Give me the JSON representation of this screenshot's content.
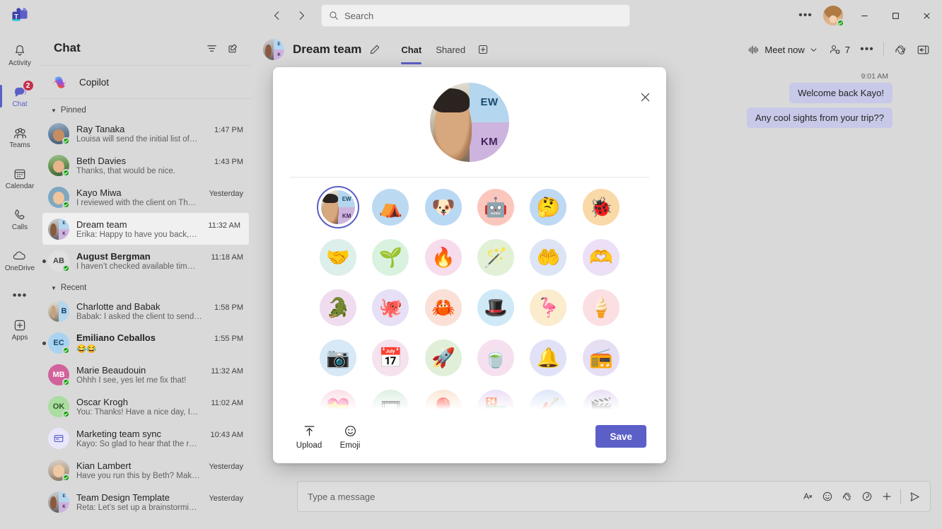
{
  "titlebar": {
    "app_name": "Microsoft Teams",
    "back_icon": "chevron-left-icon",
    "forward_icon": "chevron-right-icon",
    "search_placeholder": "Search",
    "search_icon": "search-icon",
    "more_label": "•••",
    "minimize_label": "–",
    "maximize_label": "❐",
    "close_label": "✕"
  },
  "rail": {
    "items": [
      {
        "label": "Activity",
        "icon": "bell-icon",
        "badge": "",
        "active": false
      },
      {
        "label": "Chat",
        "icon": "chat-bubble-icon",
        "badge": "2",
        "active": true
      },
      {
        "label": "Teams",
        "icon": "teams-people-icon",
        "badge": "",
        "active": false
      },
      {
        "label": "Calendar",
        "icon": "calendar-icon",
        "badge": "",
        "active": false
      },
      {
        "label": "Calls",
        "icon": "phone-icon",
        "badge": "",
        "active": false
      },
      {
        "label": "OneDrive",
        "icon": "cloud-icon",
        "badge": "",
        "active": false
      }
    ],
    "more_label": "•••",
    "apps_label": "Apps",
    "apps_icon": "plus-square-icon"
  },
  "chat_pane": {
    "title": "Chat",
    "filter_icon": "filter-icon",
    "compose_icon": "new-chat-icon",
    "copilot_label": "Copilot",
    "copilot_icon": "copilot-icon",
    "groups": [
      {
        "label": "Pinned",
        "items": [
          {
            "name": "Ray Tanaka",
            "preview": "Louisa will send the initial list of…",
            "time": "1:47 PM",
            "unread": false,
            "selected": false,
            "avatar_type": "photo",
            "photo": "ph1",
            "presence": true
          },
          {
            "name": "Beth Davies",
            "preview": "Thanks, that would be nice.",
            "time": "1:43 PM",
            "unread": false,
            "selected": false,
            "avatar_type": "photo",
            "photo": "ph2",
            "presence": true
          },
          {
            "name": "Kayo Miwa",
            "preview": "I reviewed with the client on Th…",
            "time": "Yesterday",
            "unread": false,
            "selected": false,
            "avatar_type": "photo",
            "photo": "ph3",
            "presence": true
          },
          {
            "name": "Dream team",
            "preview": "Erika: Happy to have you back,…",
            "time": "11:32 AM",
            "unread": false,
            "selected": true,
            "avatar_type": "split",
            "photo": "ph5",
            "initials_top": "E",
            "initials_bottom": "K",
            "presence": false
          },
          {
            "name": "August Bergman",
            "preview": "I haven’t checked available tim…",
            "time": "11:18 AM",
            "unread": true,
            "selected": false,
            "avatar_type": "initials",
            "initials": "AB",
            "color": "#e0e0e0",
            "text_color": "#424242",
            "presence": true
          }
        ]
      },
      {
        "label": "Recent",
        "items": [
          {
            "name": "Charlotte and Babak",
            "preview": "Babak: I asked the client to send…",
            "time": "1:58 PM",
            "unread": false,
            "selected": false,
            "avatar_type": "split2",
            "photo": "ph6",
            "initials_top": "B",
            "presence": false
          },
          {
            "name": "Emiliano Ceballos",
            "preview": "😂😂",
            "time": "1:55 PM",
            "unread": true,
            "selected": false,
            "avatar_type": "initials",
            "initials": "EC",
            "color": "#a9d3f0",
            "text_color": "#1b4a6b",
            "presence": true
          },
          {
            "name": "Marie Beaudouin",
            "preview": "Ohhh I see, yes let me fix that!",
            "time": "11:32 AM",
            "unread": false,
            "selected": false,
            "avatar_type": "initials",
            "initials": "MB",
            "color": "#d2629b",
            "text_color": "#ffffff",
            "presence": true
          },
          {
            "name": "Oscar Krogh",
            "preview": "You: Thanks! Have a nice day, I…",
            "time": "11:02 AM",
            "unread": false,
            "selected": false,
            "avatar_type": "initials",
            "initials": "OK",
            "color": "#aadda0",
            "text_color": "#2c5a26",
            "presence": true
          },
          {
            "name": "Marketing team sync",
            "preview": "Kayo: So glad to hear that the r…",
            "time": "10:43 AM",
            "unread": false,
            "selected": false,
            "avatar_type": "icon",
            "icon": "meeting-icon",
            "color": "#e8e6fb",
            "text_color": "#5b5fc7",
            "presence": false
          },
          {
            "name": "Kian Lambert",
            "preview": "Have you run this by Beth? Mak…",
            "time": "Yesterday",
            "unread": false,
            "selected": false,
            "avatar_type": "photo",
            "photo": "ph4",
            "presence": true
          },
          {
            "name": "Team Design Template",
            "preview": "Reta: Let’s set up a brainstormi…",
            "time": "Yesterday",
            "unread": false,
            "selected": false,
            "avatar_type": "split",
            "photo": "ph5",
            "initials_top": "E",
            "initials_bottom": "K",
            "presence": false
          }
        ]
      }
    ]
  },
  "conversation": {
    "title": "Dream team",
    "edit_icon": "pencil-icon",
    "tabs": [
      {
        "label": "Chat",
        "active": true
      },
      {
        "label": "Shared",
        "active": false
      }
    ],
    "add_tab_icon": "plus-square-icon",
    "meet_now_label": "Meet now",
    "meet_now_icon": "meet-now-icon",
    "meet_now_chevron": "chevron-down-icon",
    "participants_icon": "add-people-icon",
    "participants_count": "7",
    "overflow_label": "•••",
    "copilot_icon": "copilot-icon",
    "open_pane_icon": "side-pane-icon",
    "messages": [
      {
        "time": "9:01 AM",
        "text": "Welcome back Kayo!",
        "align": "right"
      },
      {
        "time": "",
        "text": "Any cool sights from your trip??",
        "align": "right"
      }
    ],
    "compose": {
      "placeholder": "Type a message",
      "icons": [
        "format-icon",
        "emoji-icon",
        "copilot-icon",
        "sticker-icon",
        "plus-icon",
        "send-icon"
      ]
    }
  },
  "dialog": {
    "name": "avatar-picker",
    "close_icon": "close-icon",
    "hero": {
      "initial_top": "EW",
      "initial_bottom": "KM",
      "top_color": "#b4d6ee",
      "bottom_color": "#cdb4de"
    },
    "avatars": [
      {
        "name": "current-group-avatar",
        "type": "selected",
        "initial_top": "EW",
        "initial_bottom": "KM",
        "bg": "#ffffff"
      },
      {
        "name": "camping-avatar",
        "emoji": "⛺",
        "bg": "#bcd9f2"
      },
      {
        "name": "dog-avatar",
        "emoji": "🐶",
        "bg": "#b9d8f3"
      },
      {
        "name": "robot-avatar",
        "emoji": "🤖",
        "bg": "#fbc7bd"
      },
      {
        "name": "thinking-face-avatar",
        "emoji": "🤔",
        "bg": "#bdd9f4"
      },
      {
        "name": "bug-avatar",
        "emoji": "🐞",
        "bg": "#fad9a8"
      },
      {
        "name": "teamwork-hands-avatar",
        "emoji": "🤝",
        "bg": "#dcefeb"
      },
      {
        "name": "leaf-in-hand-avatar",
        "emoji": "🌱",
        "bg": "#d9f2e0"
      },
      {
        "name": "flame-in-hands-avatar",
        "emoji": "🔥",
        "bg": "#f7dced"
      },
      {
        "name": "magic-wand-avatar",
        "emoji": "🪄",
        "bg": "#e2f1d6"
      },
      {
        "name": "handshake-avatar",
        "emoji": "🤲",
        "bg": "#dde4f6"
      },
      {
        "name": "heart-hands-avatar",
        "emoji": "🫶",
        "bg": "#ece0f6"
      },
      {
        "name": "dinosaur-avatar",
        "emoji": "🐊",
        "bg": "#f0dcef"
      },
      {
        "name": "octopus-avatar",
        "emoji": "🐙",
        "bg": "#e6dff5"
      },
      {
        "name": "crab-avatar",
        "emoji": "🦀",
        "bg": "#fae0d6"
      },
      {
        "name": "bunny-in-hat-avatar",
        "emoji": "🎩",
        "bg": "#cfe9f7"
      },
      {
        "name": "flamingo-avatar",
        "emoji": "🦩",
        "bg": "#fbeccd"
      },
      {
        "name": "ice-cream-avatar",
        "emoji": "🍦",
        "bg": "#fbdfe3"
      },
      {
        "name": "camera-avatar",
        "emoji": "📷",
        "bg": "#d7e8f6"
      },
      {
        "name": "calendar-avatar",
        "emoji": "📅",
        "bg": "#f6e2ee"
      },
      {
        "name": "rocket-avatar",
        "emoji": "🚀",
        "bg": "#e1efd9"
      },
      {
        "name": "teacup-avatar",
        "emoji": "🍵",
        "bg": "#f6e0ef"
      },
      {
        "name": "bell-avatar",
        "emoji": "🔔",
        "bg": "#e1e2f7"
      },
      {
        "name": "boombox-avatar",
        "emoji": "📻",
        "bg": "#e6dff4"
      },
      {
        "name": "heart-avatar",
        "emoji": "💝",
        "bg": "#fbdfe6"
      },
      {
        "name": "film-reel-avatar",
        "emoji": "🎞",
        "bg": "#ddf0e4"
      },
      {
        "name": "hot-air-balloon-avatar",
        "emoji": "🎈",
        "bg": "#fbe7d5"
      },
      {
        "name": "storefront-avatar",
        "emoji": "🏪",
        "bg": "#ecdff6"
      },
      {
        "name": "guitar-avatar",
        "emoji": "🎸",
        "bg": "#dee6f8"
      },
      {
        "name": "video-folder-avatar",
        "emoji": "🎬",
        "bg": "#e9e0f5"
      }
    ],
    "footer": {
      "upload_label": "Upload",
      "upload_icon": "upload-icon",
      "emoji_label": "Emoji",
      "emoji_icon": "emoji-icon",
      "save_label": "Save",
      "save_color": "#5b5fc7"
    }
  }
}
